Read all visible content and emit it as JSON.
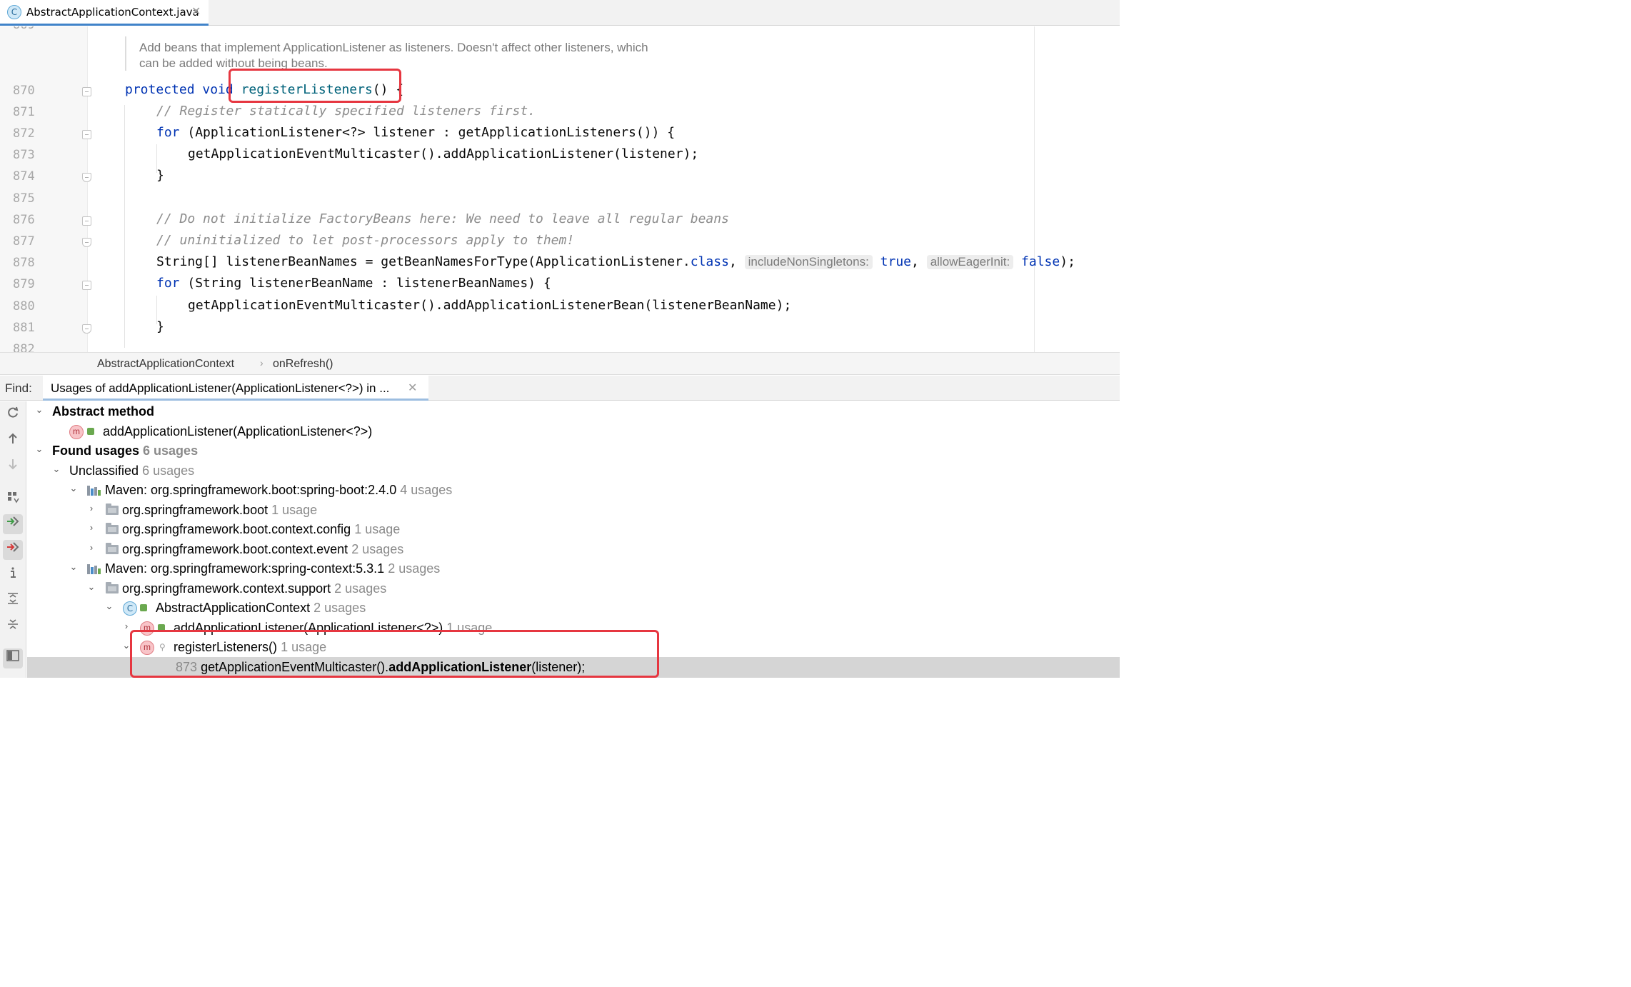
{
  "tab": {
    "icon_letter": "C",
    "title": "AbstractApplicationContext.java",
    "close_glyph": "✕"
  },
  "editor": {
    "doc_lines": [
      "Add beans that implement ApplicationListener as listeners. Doesn't affect other listeners, which",
      "can be added without being beans."
    ],
    "line_numbers": [
      "870",
      "871",
      "872",
      "873",
      "874",
      "875",
      "876",
      "877",
      "878",
      "879",
      "880",
      "881",
      "882"
    ],
    "top_partial_line_number": "869",
    "code": {
      "l870_kw": "protected void ",
      "l870_fn": "registerListeners",
      "l870_rest": "() {",
      "l871": "// Register statically specified listeners first.",
      "l872_kw": "for",
      "l872_rest": " (ApplicationListener<?> listener : getApplicationListeners()) {",
      "l873": "getApplicationEventMulticaster().addApplicationListener(listener);",
      "l874": "}",
      "l876": "// Do not initialize FactoryBeans here: We need to leave all regular beans",
      "l877": "// uninitialized to let post-processors apply to them!",
      "l878_a": "String[] listenerBeanNames = getBeanNamesForType(ApplicationListener.",
      "l878_kw1": "class",
      "l878_b": ", ",
      "l878_hint1": "includeNonSingletons:",
      "l878_kw2": "true",
      "l878_c": ", ",
      "l878_hint2": "allowEagerInit:",
      "l878_kw3": "false",
      "l878_d": ");",
      "l879_kw": "for",
      "l879_rest": " (String listenerBeanName : listenerBeanNames) {",
      "l880": "getApplicationEventMulticaster().addApplicationListenerBean(listenerBeanName);",
      "l881": "}"
    }
  },
  "breadcrumb": {
    "items": [
      "AbstractApplicationContext",
      "onRefresh()"
    ],
    "separator": "›"
  },
  "find": {
    "label": "Find:",
    "tab_title": "Usages of addApplicationListener(ApplicationListener<?>) in ...",
    "close_glyph": "✕"
  },
  "toolstrip": {
    "icons": [
      "rerun-icon",
      "previous-occurrence-icon",
      "next-occurrence-icon",
      "group-by-icon",
      "navigate-to-source-icon",
      "exclude-icon",
      "info-icon",
      "expand-all-icon",
      "collapse-all-icon",
      "preview-icon"
    ]
  },
  "tree": {
    "abstract_method": {
      "label": "Abstract method"
    },
    "abstract_method_item": {
      "label": "addApplicationListener(ApplicationListener<?>)"
    },
    "found_usages": {
      "label": "Found usages",
      "count": "6 usages"
    },
    "unclassified": {
      "label": "Unclassified",
      "count": "6 usages"
    },
    "maven_boot": {
      "label": "Maven: org.springframework.boot:spring-boot:2.4.0",
      "count": "4 usages"
    },
    "pkg_boot": {
      "label": "org.springframework.boot",
      "count": "1 usage"
    },
    "pkg_boot_context_config": {
      "label": "org.springframework.boot.context.config",
      "count": "1 usage"
    },
    "pkg_boot_context_event": {
      "label": "org.springframework.boot.context.event",
      "count": "2 usages"
    },
    "maven_context": {
      "label": "Maven: org.springframework:spring-context:5.3.1",
      "count": "2 usages"
    },
    "pkg_context_support": {
      "label": "org.springframework.context.support",
      "count": "2 usages"
    },
    "class_aac": {
      "label": "AbstractApplicationContext",
      "count": "2 usages",
      "icon_letter": "C"
    },
    "method_add": {
      "label": "addApplicationListener(ApplicationListener<?>)",
      "count": "1 usage",
      "icon_letter": "m"
    },
    "method_register": {
      "label": "registerListeners()",
      "count": "1 usage",
      "icon_letter": "m"
    },
    "usage_line": {
      "line": "873",
      "prefix": "getApplicationEventMulticaster().",
      "match": "addApplicationListener",
      "suffix": "(listener);"
    }
  },
  "colors": {
    "keyword": "#0033b3",
    "comment": "#8c8c8c",
    "method_declaration": "#00627a",
    "highlight_box": "#e63640",
    "selection": "#d5d5d5",
    "tab_underline": "#4083c9"
  }
}
